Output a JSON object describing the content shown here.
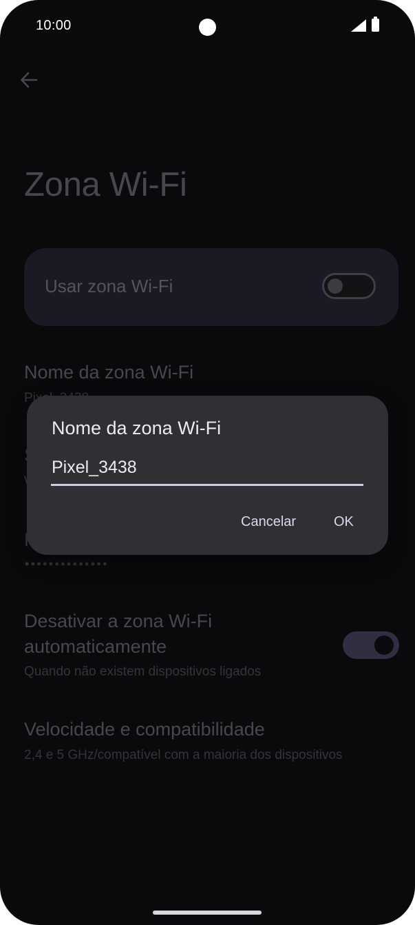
{
  "status_bar": {
    "time": "10:00"
  },
  "header": {
    "title": "Zona Wi-Fi"
  },
  "main_toggle": {
    "label": "Usar zona Wi-Fi",
    "checked": false
  },
  "settings": {
    "hotspot_name": {
      "title": "Nome da zona Wi-Fi",
      "summary": "Pixel_3438"
    },
    "security_peek": "S",
    "security_summary_peek": "W",
    "password_peek": "P",
    "password_dots": "••••••••••••••",
    "auto_off": {
      "title_line1": "Desativar a zona Wi-Fi",
      "title_line2": "automaticamente",
      "summary": "Quando não existem dispositivos ligados",
      "checked": true
    },
    "speed": {
      "title": "Velocidade e compatibilidade",
      "summary": "2,4 e 5 GHz/compatível com a maioria dos dispositivos"
    }
  },
  "dialog": {
    "title": "Nome da zona Wi-Fi",
    "input_value": "Pixel_3438",
    "cancel_label": "Cancelar",
    "ok_label": "OK"
  },
  "icons": {
    "back": "arrow-back-icon",
    "signal": "cell-signal-icon",
    "battery": "battery-icon"
  },
  "colors": {
    "background": "#0f0e12",
    "card": "#2a2636",
    "dialog": "#302f34",
    "accent": "#d0cce0",
    "switch_on_track": "#4b4560"
  }
}
